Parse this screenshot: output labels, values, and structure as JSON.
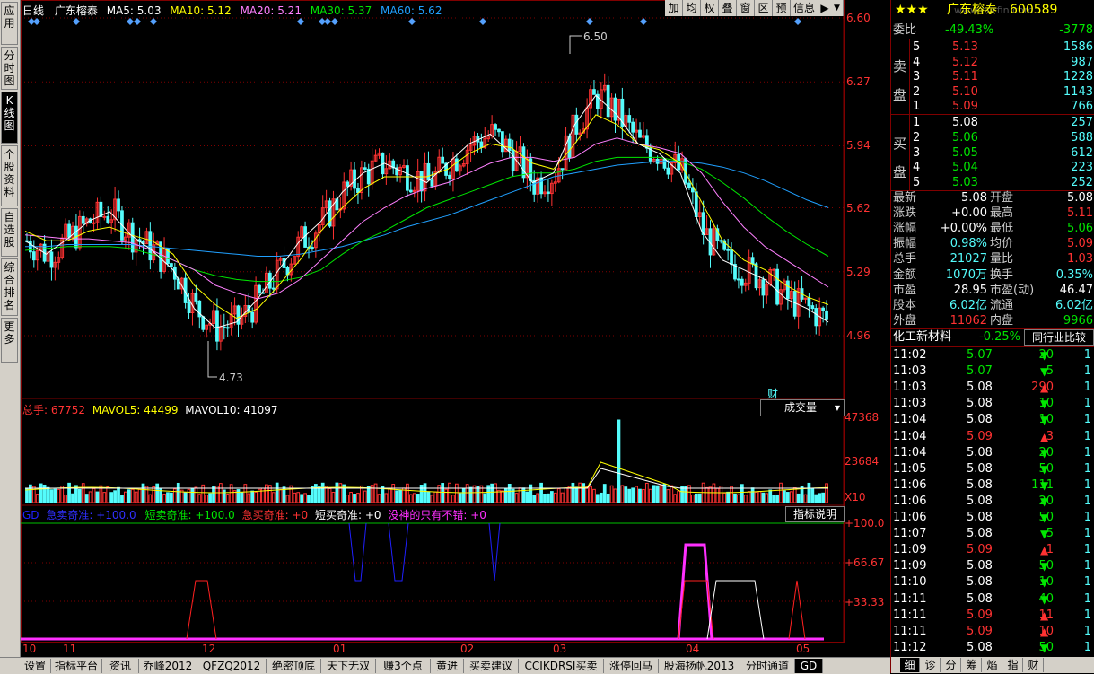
{
  "left_tabs": [
    "应用",
    "分时图",
    "K线图",
    "个股资料",
    "自选股",
    "综合排名",
    "更多"
  ],
  "chart_header": {
    "period": "日线",
    "stock": "广东榕泰",
    "ma5": "MA5: 5.03",
    "ma10": "MA10: 5.12",
    "ma20": "MA20: 5.21",
    "ma30": "MA30: 5.37",
    "ma60": "MA60: 5.62"
  },
  "toolbar": [
    "加",
    "均",
    "权",
    "叠",
    "窗",
    "区",
    "预",
    "信息"
  ],
  "price_axis": [
    "6.60",
    "6.27",
    "5.94",
    "5.62",
    "5.29",
    "4.96"
  ],
  "high_label": "6.50",
  "low_label": "4.73",
  "cai": "财",
  "volume_header": {
    "total": "总手: 67752",
    "mavol5": "MAVOL5: 44499",
    "mavol10": "MAVOL10: 41097"
  },
  "volume_dropdown": "成交量",
  "volume_axis": [
    "47368",
    "23684",
    "X10"
  ],
  "indicator_header": {
    "gd": "GD",
    "a": "急卖奇准: +100.0",
    "b": "短卖奇准: +100.0",
    "c": "急买奇准: +0",
    "d": "短买奇准: +0",
    "e": "没神的只有不错: +0"
  },
  "indicator_btn": "指标说明",
  "indicator_axis": [
    "+100.0",
    "+66.67",
    "+33.33"
  ],
  "date_labels": [
    "10",
    "11",
    "12",
    "01",
    "02",
    "03",
    "04",
    "05"
  ],
  "bottom_tabs": [
    "设置",
    "指标平台",
    "资讯",
    "乔峰2012",
    "QFZQ2012",
    "绝密顶底",
    "天下无双",
    "赚3个点",
    "黄进",
    "买卖建议",
    "CCIKDRSI买卖",
    "涨停回马",
    "股海扬帆2013",
    "分时通道",
    "GD"
  ],
  "panel": {
    "stars": "★★★",
    "name": "广东榕泰",
    "code": "600589",
    "watermark": "www.ourfin.com",
    "weibi_label": "委比",
    "weibi": "-49.43%",
    "weicha": "-3778",
    "sell_label": "卖盘",
    "buy_label": "买盘",
    "sells": [
      {
        "n": "5",
        "p": "5.13",
        "v": "1586"
      },
      {
        "n": "4",
        "p": "5.12",
        "v": "987"
      },
      {
        "n": "3",
        "p": "5.11",
        "v": "1228"
      },
      {
        "n": "2",
        "p": "5.10",
        "v": "1143"
      },
      {
        "n": "1",
        "p": "5.09",
        "v": "766"
      }
    ],
    "buys": [
      {
        "n": "1",
        "p": "5.08",
        "v": "257"
      },
      {
        "n": "2",
        "p": "5.06",
        "v": "588"
      },
      {
        "n": "3",
        "p": "5.05",
        "v": "612"
      },
      {
        "n": "4",
        "p": "5.04",
        "v": "223"
      },
      {
        "n": "5",
        "p": "5.03",
        "v": "252"
      }
    ],
    "stats": [
      {
        "l1": "最新",
        "v1": "5.08",
        "c1": "white",
        "l2": "开盘",
        "v2": "5.08",
        "c2": "white"
      },
      {
        "l1": "涨跌",
        "v1": "+0.00",
        "c1": "white",
        "l2": "最高",
        "v2": "5.11",
        "c2": "red"
      },
      {
        "l1": "涨幅",
        "v1": "+0.00%",
        "c1": "white",
        "l2": "最低",
        "v2": "5.06",
        "c2": "green"
      },
      {
        "l1": "振幅",
        "v1": "0.98%",
        "c1": "cyan",
        "l2": "均价",
        "v2": "5.09",
        "c2": "red"
      },
      {
        "l1": "总手",
        "v1": "21027",
        "c1": "cyan",
        "l2": "量比",
        "v2": "1.03",
        "c2": "red"
      },
      {
        "l1": "金额",
        "v1": "1070万",
        "c1": "cyan",
        "l2": "换手",
        "v2": "0.35%",
        "c2": "cyan"
      },
      {
        "l1": "市盈",
        "v1": "28.95",
        "c1": "white",
        "l2": "市盈(动)",
        "v2": "46.47",
        "c2": "white"
      },
      {
        "l1": "股本",
        "v1": "6.02亿",
        "c1": "cyan",
        "l2": "流通",
        "v2": "6.02亿",
        "c2": "cyan"
      },
      {
        "l1": "外盘",
        "v1": "11062",
        "c1": "red",
        "l2": "内盘",
        "v2": "9966",
        "c2": "green"
      }
    ],
    "industry": "化工新材料",
    "industry_pct": "-0.25%",
    "industry_btn": "同行业比较",
    "ticks": [
      {
        "t": "11:02",
        "p": "5.07",
        "pc": "green",
        "v": "20",
        "d": "down",
        "n": "1"
      },
      {
        "t": "11:03",
        "p": "5.07",
        "pc": "green",
        "v": "5",
        "d": "down",
        "n": "1"
      },
      {
        "t": "11:03",
        "p": "5.08",
        "pc": "white",
        "v": "290",
        "d": "up",
        "n": "1"
      },
      {
        "t": "11:03",
        "p": "5.08",
        "pc": "white",
        "v": "10",
        "d": "down",
        "n": "1"
      },
      {
        "t": "11:04",
        "p": "5.08",
        "pc": "white",
        "v": "10",
        "d": "down",
        "n": "1"
      },
      {
        "t": "11:04",
        "p": "5.09",
        "pc": "red",
        "v": "3",
        "d": "up",
        "n": "1"
      },
      {
        "t": "11:04",
        "p": "5.08",
        "pc": "white",
        "v": "20",
        "d": "down",
        "n": "1"
      },
      {
        "t": "11:05",
        "p": "5.08",
        "pc": "white",
        "v": "50",
        "d": "down",
        "n": "1"
      },
      {
        "t": "11:06",
        "p": "5.08",
        "pc": "white",
        "v": "111",
        "d": "down",
        "n": "1"
      },
      {
        "t": "11:06",
        "p": "5.08",
        "pc": "white",
        "v": "20",
        "d": "down",
        "n": "1"
      },
      {
        "t": "11:06",
        "p": "5.08",
        "pc": "white",
        "v": "50",
        "d": "down",
        "n": "1"
      },
      {
        "t": "11:07",
        "p": "5.08",
        "pc": "white",
        "v": "5",
        "d": "down",
        "n": "1"
      },
      {
        "t": "11:09",
        "p": "5.09",
        "pc": "red",
        "v": "1",
        "d": "up",
        "n": "1"
      },
      {
        "t": "11:09",
        "p": "5.08",
        "pc": "white",
        "v": "50",
        "d": "down",
        "n": "1"
      },
      {
        "t": "11:10",
        "p": "5.08",
        "pc": "white",
        "v": "10",
        "d": "down",
        "n": "1"
      },
      {
        "t": "11:11",
        "p": "5.08",
        "pc": "white",
        "v": "40",
        "d": "down",
        "n": "1"
      },
      {
        "t": "11:11",
        "p": "5.09",
        "pc": "red",
        "v": "11",
        "d": "up",
        "n": "1"
      },
      {
        "t": "11:11",
        "p": "5.09",
        "pc": "red",
        "v": "10",
        "d": "up",
        "n": "1"
      },
      {
        "t": "11:12",
        "p": "5.08",
        "pc": "white",
        "v": "50",
        "d": "down",
        "n": "1"
      }
    ],
    "bottom_tabs": [
      "细",
      "诊",
      "分",
      "筹",
      "焰",
      "指",
      "财"
    ]
  },
  "colors": {
    "up": "#ff3232",
    "down": "#54fcfc",
    "ma5": "#ffffff",
    "ma10": "#ffff00",
    "ma20": "#ff80ff",
    "ma30": "#00e600",
    "ma60": "#20a0ff",
    "grid": "#800000"
  },
  "chart_data": {
    "type": "candlestick",
    "ylim": [
      4.73,
      6.6
    ],
    "x": [
      "10",
      "11",
      "12",
      "01",
      "02",
      "03",
      "04",
      "05"
    ],
    "high": 6.5,
    "low": 4.73,
    "series": [
      {
        "name": "MA5",
        "value": 5.03
      },
      {
        "name": "MA10",
        "value": 5.12
      },
      {
        "name": "MA20",
        "value": 5.21
      },
      {
        "name": "MA30",
        "value": 5.37
      },
      {
        "name": "MA60",
        "value": 5.62
      }
    ],
    "volume": {
      "total": 67752,
      "mavol5": 44499,
      "mavol10": 41097,
      "ylim": [
        0,
        47368
      ]
    },
    "ma5_path": [
      5.45,
      5.38,
      5.46,
      5.55,
      5.6,
      5.48,
      5.4,
      5.3,
      5.1,
      5.0,
      5.03,
      5.15,
      5.3,
      5.45,
      5.55,
      5.7,
      5.8,
      5.85,
      5.8,
      5.75,
      5.85,
      5.95,
      6.0,
      5.9,
      5.75,
      5.8,
      6.05,
      6.2,
      6.1,
      5.95,
      5.9,
      5.8,
      5.5,
      5.35,
      5.3,
      5.25,
      5.15,
      5.1,
      5.03
    ],
    "ma10_path": [
      5.5,
      5.45,
      5.45,
      5.5,
      5.52,
      5.48,
      5.45,
      5.38,
      5.22,
      5.12,
      5.05,
      5.1,
      5.22,
      5.35,
      5.5,
      5.62,
      5.72,
      5.78,
      5.78,
      5.78,
      5.82,
      5.9,
      5.95,
      5.93,
      5.85,
      5.82,
      5.95,
      6.1,
      6.05,
      5.95,
      5.92,
      5.85,
      5.65,
      5.45,
      5.35,
      5.3,
      5.22,
      5.16,
      5.12
    ],
    "ma20_path": [
      5.48,
      5.47,
      5.46,
      5.46,
      5.45,
      5.44,
      5.4,
      5.35,
      5.3,
      5.22,
      5.18,
      5.15,
      5.18,
      5.25,
      5.35,
      5.45,
      5.55,
      5.62,
      5.68,
      5.72,
      5.75,
      5.8,
      5.85,
      5.88,
      5.88,
      5.86,
      5.88,
      5.95,
      5.98,
      5.95,
      5.93,
      5.9,
      5.8,
      5.65,
      5.52,
      5.42,
      5.35,
      5.28,
      5.21
    ],
    "ma30_path": [
      5.4,
      5.41,
      5.42,
      5.42,
      5.42,
      5.41,
      5.38,
      5.35,
      5.3,
      5.27,
      5.25,
      5.24,
      5.24,
      5.26,
      5.3,
      5.38,
      5.45,
      5.5,
      5.56,
      5.62,
      5.66,
      5.7,
      5.74,
      5.78,
      5.8,
      5.8,
      5.82,
      5.86,
      5.88,
      5.88,
      5.88,
      5.86,
      5.82,
      5.75,
      5.67,
      5.58,
      5.5,
      5.43,
      5.37
    ],
    "ma60_path": [
      5.42,
      5.42,
      5.43,
      5.43,
      5.43,
      5.43,
      5.42,
      5.41,
      5.4,
      5.39,
      5.38,
      5.37,
      5.37,
      5.38,
      5.4,
      5.42,
      5.45,
      5.48,
      5.52,
      5.55,
      5.58,
      5.62,
      5.66,
      5.7,
      5.74,
      5.78,
      5.8,
      5.82,
      5.84,
      5.85,
      5.86,
      5.86,
      5.85,
      5.83,
      5.8,
      5.76,
      5.71,
      5.66,
      5.62
    ]
  }
}
